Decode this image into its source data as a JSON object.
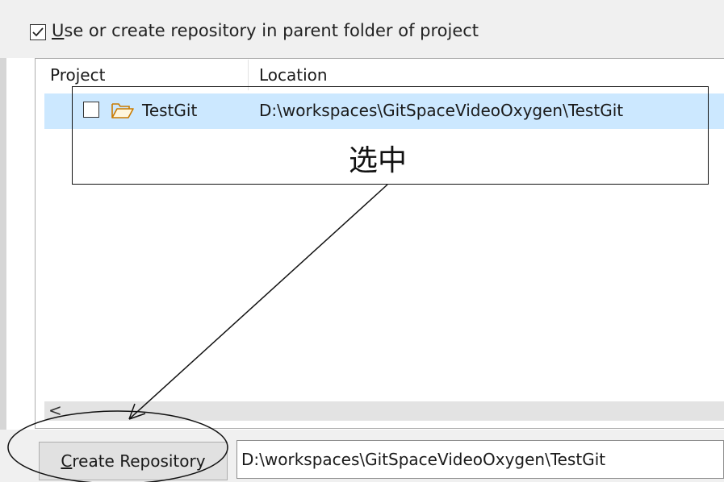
{
  "option": {
    "checked": true,
    "label_mnemonic": "U",
    "label_rest": "se or create repository in parent folder of project"
  },
  "table": {
    "columns": [
      "Project",
      "Location"
    ],
    "rows": [
      {
        "checked": false,
        "icon": "folder-open-icon",
        "name": "TestGit",
        "location": "D:\\workspaces\\GitSpaceVideoOxygen\\TestGit",
        "selected": true
      }
    ],
    "scroll_left_glyph": "<"
  },
  "bottom": {
    "create_button_mnemonic": "C",
    "create_button_rest": "reate Repository",
    "path_value": "D:\\workspaces\\GitSpaceVideoOxygen\\TestGit"
  },
  "annotation": {
    "text": "选中"
  },
  "colors": {
    "selection": "#cce8ff",
    "annotation": "#111111"
  }
}
